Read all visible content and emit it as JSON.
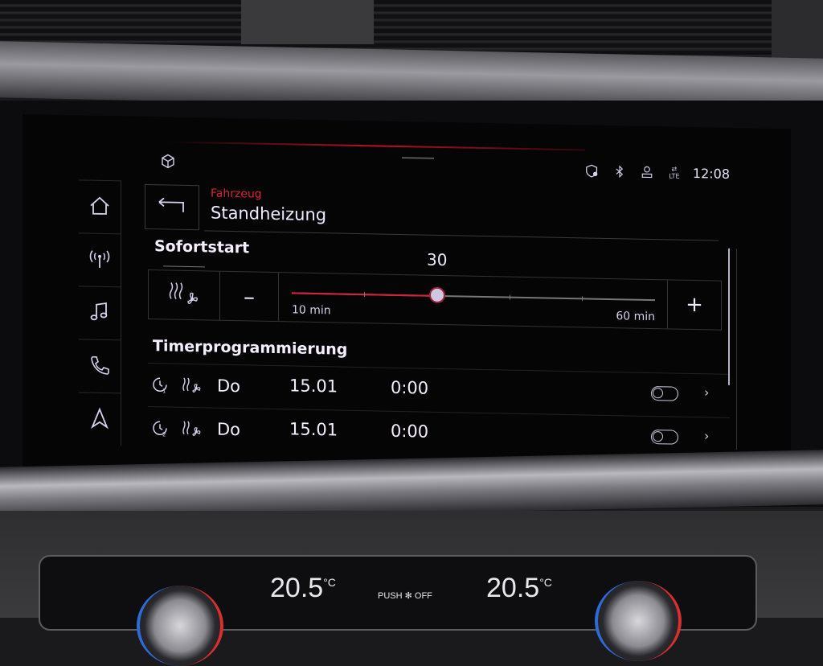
{
  "status_bar": {
    "time": "12:08",
    "network": "LTE",
    "icons": [
      "cube-3d-icon",
      "location-shield-icon",
      "bluetooth-icon",
      "user-icon",
      "lte-data-icon"
    ]
  },
  "nav": {
    "items": [
      {
        "name": "home",
        "icon": "home-icon"
      },
      {
        "name": "radio",
        "icon": "radio-antenna-icon"
      },
      {
        "name": "media",
        "icon": "music-note-icon"
      },
      {
        "name": "phone",
        "icon": "phone-icon"
      },
      {
        "name": "navigation",
        "icon": "navigation-arrow-icon"
      }
    ]
  },
  "header": {
    "breadcrumb": "Fahrzeug",
    "title": "Standheizung",
    "back_icon": "back-arrow-icon"
  },
  "sofortstart": {
    "title": "Sofortstart",
    "mode_icon": "seat-heat-fan-icon",
    "minus_label": "–",
    "plus_label": "+",
    "slider": {
      "value": "30",
      "min_label": "10 min",
      "max_label": "60 min",
      "min": 10,
      "max": 60,
      "current": 30
    }
  },
  "timer": {
    "title": "Timerprogrammierung",
    "rows": [
      {
        "slot": "1",
        "day": "Do",
        "date": "15.01",
        "time": "0:00",
        "enabled": false
      },
      {
        "slot": "2",
        "day": "Do",
        "date": "15.01",
        "time": "0:00",
        "enabled": false
      }
    ],
    "chevron": "›"
  },
  "climate": {
    "left_temp": "20.5",
    "right_temp": "20.5",
    "unit": "°C",
    "push_label": "PUSH",
    "off_label": "OFF"
  },
  "colors": {
    "accent_red": "#d6263a",
    "text": "#f0eaff",
    "background": "#050505"
  }
}
